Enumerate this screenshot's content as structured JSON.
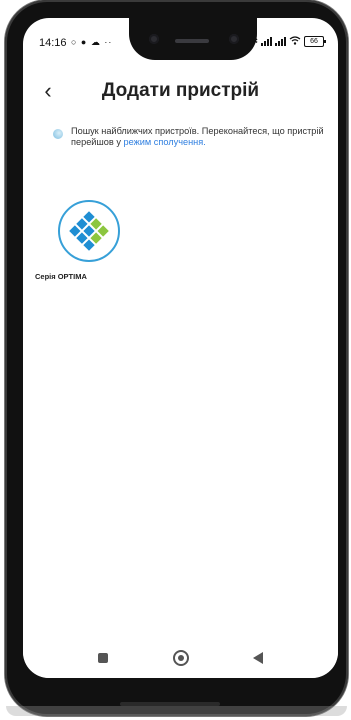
{
  "status_bar": {
    "time": "14:16",
    "left_icons": "○ ● ☁ ··",
    "bluetooth": "✱",
    "battery": "66"
  },
  "header": {
    "back_icon": "chevron-left-icon",
    "back_glyph": "‹",
    "title": "Додати пристрій"
  },
  "search": {
    "message": "Пошук найближчих пристроїв. Переконайтеся, що пристрій перейшов у ",
    "pairing_link": "режим сполучення."
  },
  "devices": [
    {
      "name": "Серія OPTIMA",
      "icon": "optima-logo-icon"
    }
  ],
  "colors": {
    "accent_link": "#2f7fe0",
    "logo_blue": "#1f8ed3",
    "logo_green": "#8cc63f",
    "logo_ring": "#37a0d8"
  }
}
